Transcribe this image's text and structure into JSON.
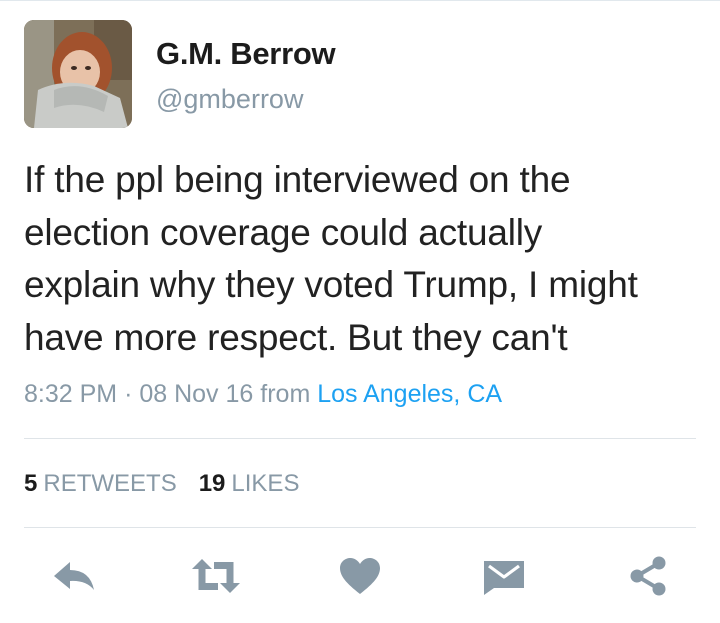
{
  "user": {
    "display_name": "G.M. Berrow",
    "handle": "@gmberrow"
  },
  "tweet": {
    "lines": [
      "If the ppl being interviewed on the",
      "election coverage could actually",
      "explain why they voted Trump, I might",
      "have more respect. But they can't"
    ]
  },
  "meta": {
    "time": "8:32 PM",
    "separator": "·",
    "date": "08 Nov 16",
    "from_label": "from",
    "location": "Los Angeles, CA"
  },
  "stats": {
    "retweets_count": "5",
    "retweets_label": "RETWEETS",
    "likes_count": "19",
    "likes_label": "LIKES"
  },
  "actions": {
    "icons": [
      "reply-icon",
      "retweet-icon",
      "like-icon",
      "message-icon",
      "share-icon"
    ]
  },
  "colors": {
    "icon_gray": "#8899a6",
    "link_blue": "#1da1f2",
    "text": "#222222",
    "divider": "#dfe4e8"
  }
}
